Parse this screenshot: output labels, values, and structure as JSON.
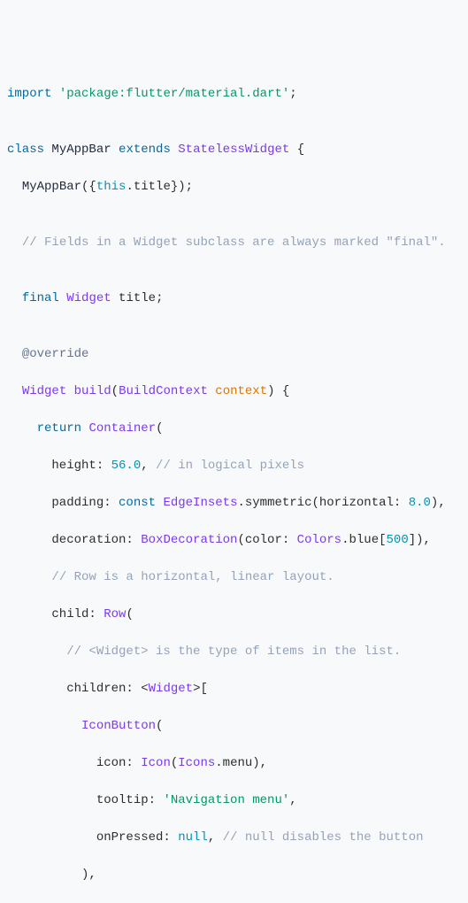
{
  "code": {
    "l1": {
      "a": "import",
      "b": " ",
      "c": "'package:flutter/material.dart'",
      "d": ";"
    },
    "l3": {
      "a": "class",
      "b": " ",
      "c": "MyAppBar",
      "d": " ",
      "e": "extends",
      "f": " ",
      "g": "StatelessWidget",
      "h": " {"
    },
    "l4": {
      "a": "  ",
      "b": "MyAppBar",
      "c": "({",
      "d": "this",
      "e": ".title});"
    },
    "l6": {
      "a": "  ",
      "b": "// Fields in a Widget subclass are always marked \"final\"."
    },
    "l8": {
      "a": "  ",
      "b": "final",
      "c": " ",
      "d": "Widget",
      "e": " title;"
    },
    "l10": {
      "a": "  ",
      "b": "@override"
    },
    "l11": {
      "a": "  ",
      "b": "Widget",
      "c": " ",
      "d": "build",
      "e": "(",
      "f": "BuildContext",
      "g": " ",
      "h": "context",
      "i": ") {"
    },
    "l12": {
      "a": "    ",
      "b": "return",
      "c": " ",
      "d": "Container",
      "e": "("
    },
    "l13": {
      "a": "      height: ",
      "b": "56.0",
      "c": ", ",
      "d": "// in logical pixels"
    },
    "l14": {
      "a": "      padding: ",
      "b": "const",
      "c": " ",
      "d": "EdgeInsets",
      "e": ".symmetric(horizontal: ",
      "f": "8.0",
      "g": "),"
    },
    "l15": {
      "a": "      decoration: ",
      "b": "BoxDecoration",
      "c": "(color: ",
      "d": "Colors",
      "e": ".blue[",
      "f": "500",
      "g": "]),"
    },
    "l16": {
      "a": "      ",
      "b": "// Row is a horizontal, linear layout."
    },
    "l17": {
      "a": "      child: ",
      "b": "Row",
      "c": "("
    },
    "l18": {
      "a": "        ",
      "b": "// <Widget> is the type of items in the list."
    },
    "l19": {
      "a": "        children: <",
      "b": "Widget",
      "c": ">["
    },
    "l20": {
      "a": "          ",
      "b": "IconButton",
      "c": "("
    },
    "l21": {
      "a": "            icon: ",
      "b": "Icon",
      "c": "(",
      "d": "Icons",
      "e": ".menu),"
    },
    "l22": {
      "a": "            tooltip: ",
      "b": "'Navigation menu'",
      "c": ","
    },
    "l23": {
      "a": "            onPressed: ",
      "b": "null",
      "c": ", ",
      "d": "// null disables the button"
    },
    "l24": {
      "a": "          ),"
    }
  }
}
